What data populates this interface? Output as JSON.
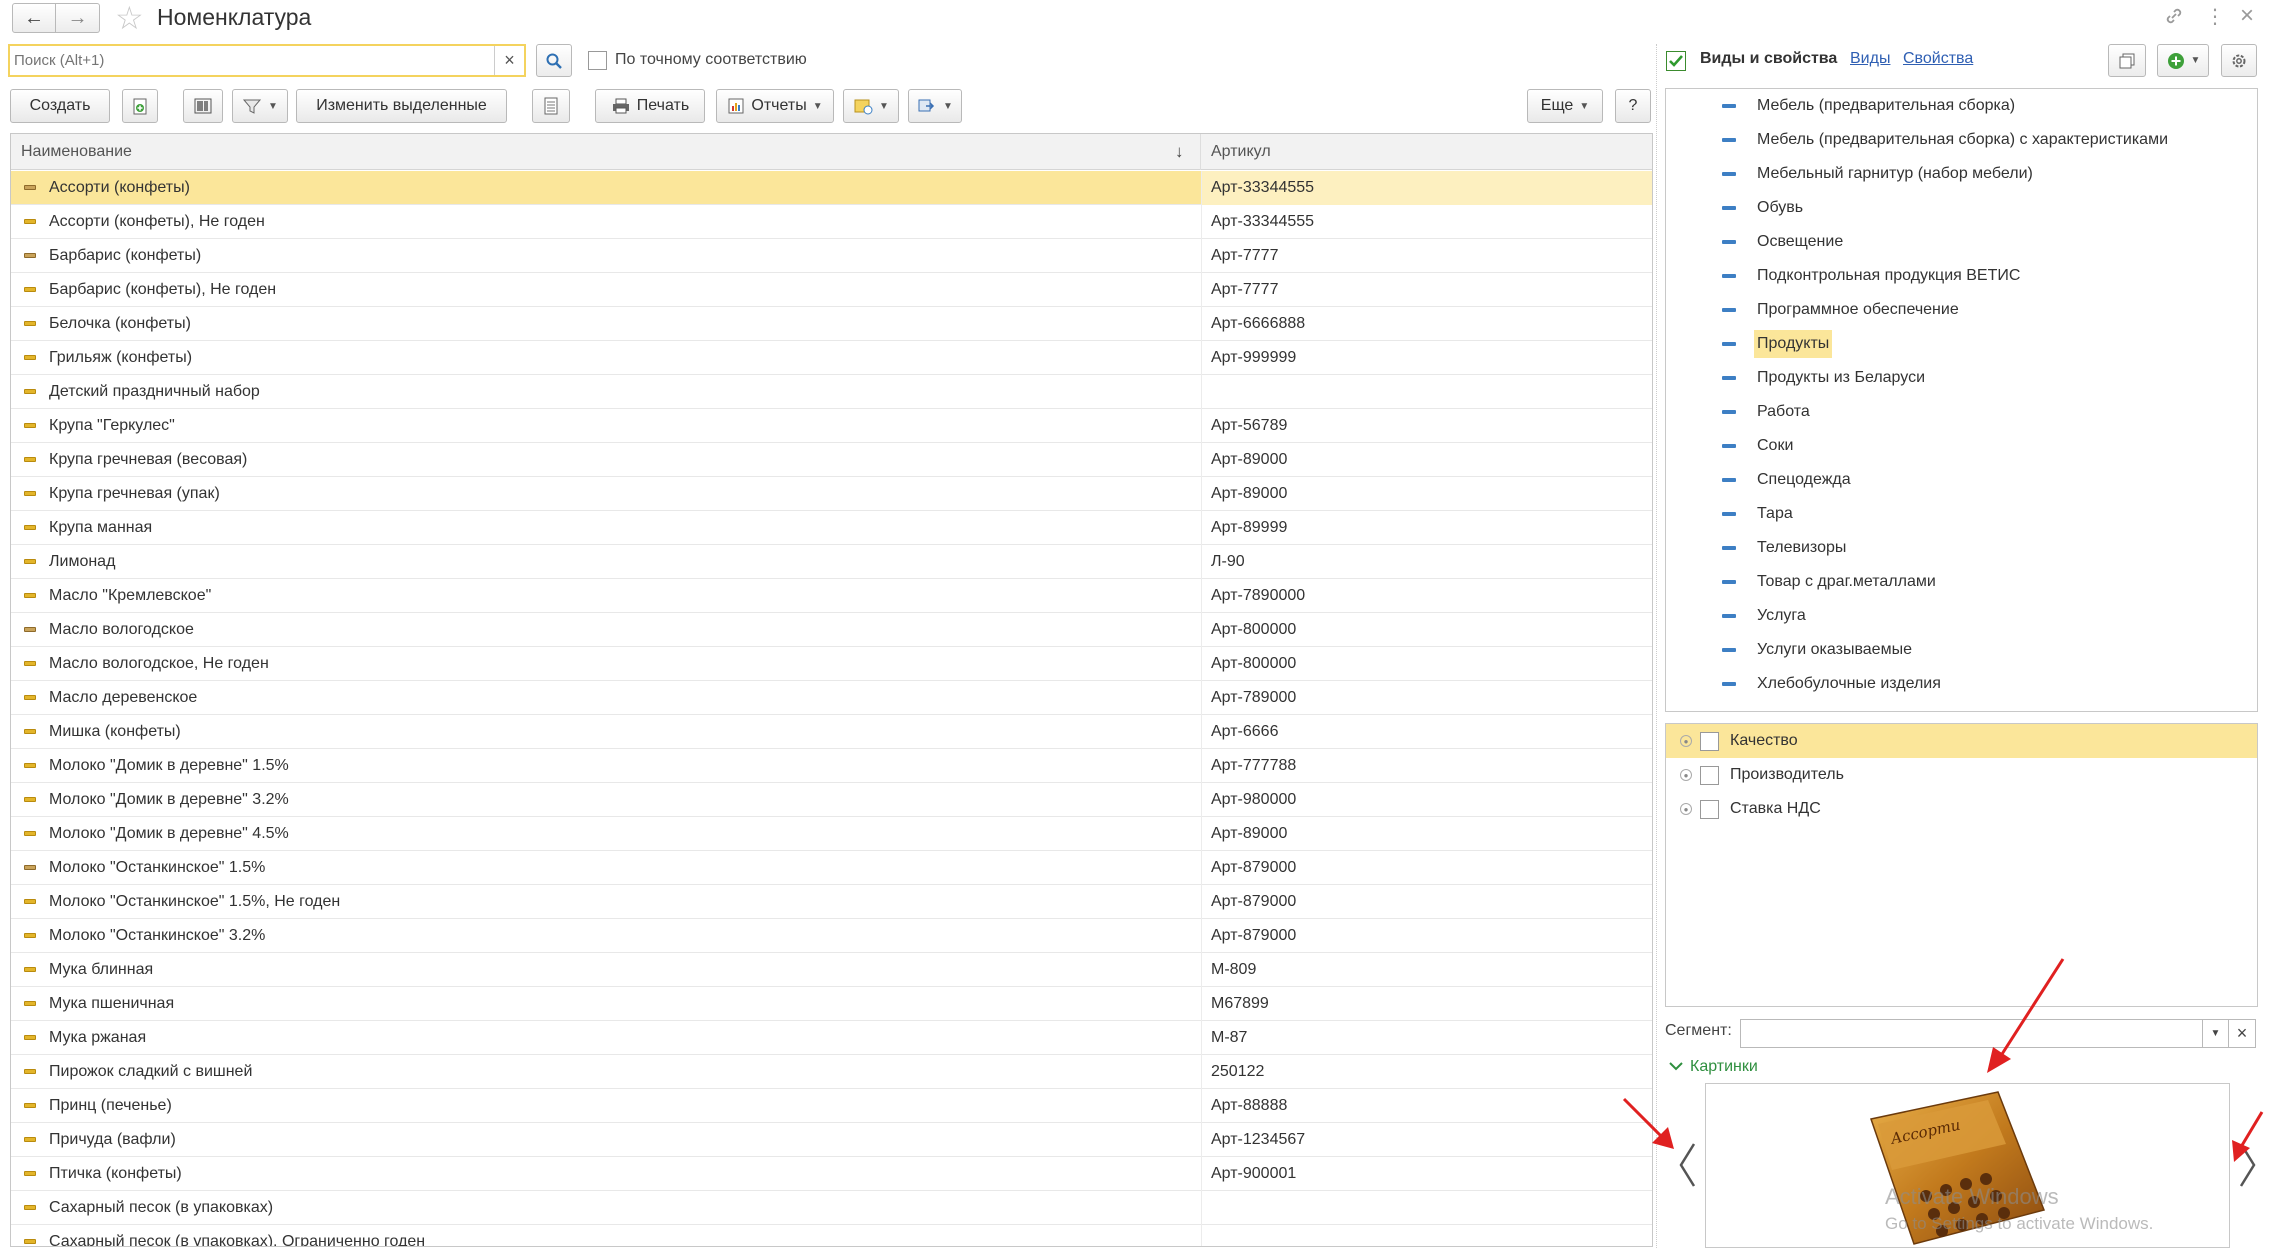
{
  "window": {
    "title": "Номенклатура"
  },
  "search": {
    "placeholder": "Поиск (Alt+1)",
    "value": "",
    "clear": "×",
    "exact_label": "По точному соответствию"
  },
  "toolbar": {
    "create": "Создать",
    "edit_selected": "Изменить выделенные",
    "print": "Печать",
    "reports": "Отчеты",
    "more": "Еще",
    "help": "?"
  },
  "table": {
    "columns": {
      "name": "Наименование",
      "article": "Артикул"
    },
    "sort_indicator": "↓",
    "rows": [
      {
        "name": "Ассорти (конфеты)",
        "article": "Арт-33344555",
        "selected": true,
        "brown": true
      },
      {
        "name": "Ассорти (конфеты), Не годен",
        "article": "Арт-33344555"
      },
      {
        "name": "Барбарис (конфеты)",
        "article": "Арт-7777",
        "brown": true
      },
      {
        "name": "Барбарис (конфеты), Не годен",
        "article": "Арт-7777"
      },
      {
        "name": "Белочка (конфеты)",
        "article": "Арт-6666888"
      },
      {
        "name": "Грильяж (конфеты)",
        "article": "Арт-999999"
      },
      {
        "name": "Детский праздничный набор",
        "article": ""
      },
      {
        "name": "Крупа \"Геркулес\"",
        "article": "Арт-56789"
      },
      {
        "name": "Крупа гречневая (весовая)",
        "article": "Арт-89000"
      },
      {
        "name": "Крупа гречневая (упак)",
        "article": "Арт-89000"
      },
      {
        "name": "Крупа манная",
        "article": "Арт-89999"
      },
      {
        "name": "Лимонад",
        "article": "Л-90"
      },
      {
        "name": "Масло \"Кремлевское\"",
        "article": "Арт-7890000"
      },
      {
        "name": "Масло вологодское",
        "article": "Арт-800000",
        "brown": true
      },
      {
        "name": "Масло вологодское, Не годен",
        "article": "Арт-800000"
      },
      {
        "name": "Масло деревенское",
        "article": "Арт-789000"
      },
      {
        "name": "Мишка (конфеты)",
        "article": "Арт-6666"
      },
      {
        "name": "Молоко \"Домик в деревне\" 1.5%",
        "article": "Арт-777788"
      },
      {
        "name": "Молоко \"Домик в деревне\" 3.2%",
        "article": "Арт-980000"
      },
      {
        "name": "Молоко \"Домик в деревне\" 4.5%",
        "article": "Арт-89000"
      },
      {
        "name": "Молоко \"Останкинское\" 1.5%",
        "article": "Арт-879000",
        "brown": true
      },
      {
        "name": "Молоко \"Останкинское\" 1.5%, Не годен",
        "article": "Арт-879000"
      },
      {
        "name": "Молоко \"Останкинское\" 3.2%",
        "article": "Арт-879000"
      },
      {
        "name": "Мука блинная",
        "article": "М-809"
      },
      {
        "name": "Мука пшеничная",
        "article": "М67899"
      },
      {
        "name": "Мука ржаная",
        "article": "М-87"
      },
      {
        "name": "Пирожок сладкий с вишней",
        "article": "250122"
      },
      {
        "name": "Принц (печенье)",
        "article": "Арт-88888"
      },
      {
        "name": "Причуда (вафли)",
        "article": "Арт-1234567"
      },
      {
        "name": "Птичка (конфеты)",
        "article": "Арт-900001"
      },
      {
        "name": "Сахарный песок (в упаковках)",
        "article": ""
      },
      {
        "name": "Сахарный песок (в упаковках), Ограниченно годен",
        "article": ""
      }
    ]
  },
  "right_panel": {
    "title": "Виды и свойства",
    "link_kinds": "Виды",
    "link_props": "Свойства",
    "kinds": [
      "Мебель (предварительная сборка)",
      "Мебель (предварительная сборка) с характеристиками",
      "Мебельный гарнитур (набор мебели)",
      "Обувь",
      "Освещение",
      "Подконтрольная продукция ВЕТИС",
      "Программное обеспечение",
      "Продукты",
      "Продукты из Беларуси",
      "Работа",
      "Соки",
      "Спецодежда",
      "Тара",
      "Телевизоры",
      "Товар с драг.металлами",
      "Услуга",
      "Услуги оказываемые",
      "Хлебобулочные изделия"
    ],
    "selected_kind_index": 7,
    "properties": [
      {
        "label": "Качество",
        "selected": true
      },
      {
        "label": "Производитель"
      },
      {
        "label": "Ставка НДС"
      }
    ],
    "segment_label": "Сегмент:",
    "segment_value": "",
    "segment_clear": "×",
    "pictures_title": "Картинки",
    "watermark_title": "Activate Windows",
    "watermark_sub": "Go to Settings to activate Windows."
  },
  "colors": {
    "selection": "#fbe69a",
    "accent_green": "#2f8f3f",
    "link_blue": "#2f5fb3",
    "kind_icon": "#3d7fc4",
    "item_icon": "#e3b52a",
    "annotation_arrow": "#e02020"
  }
}
